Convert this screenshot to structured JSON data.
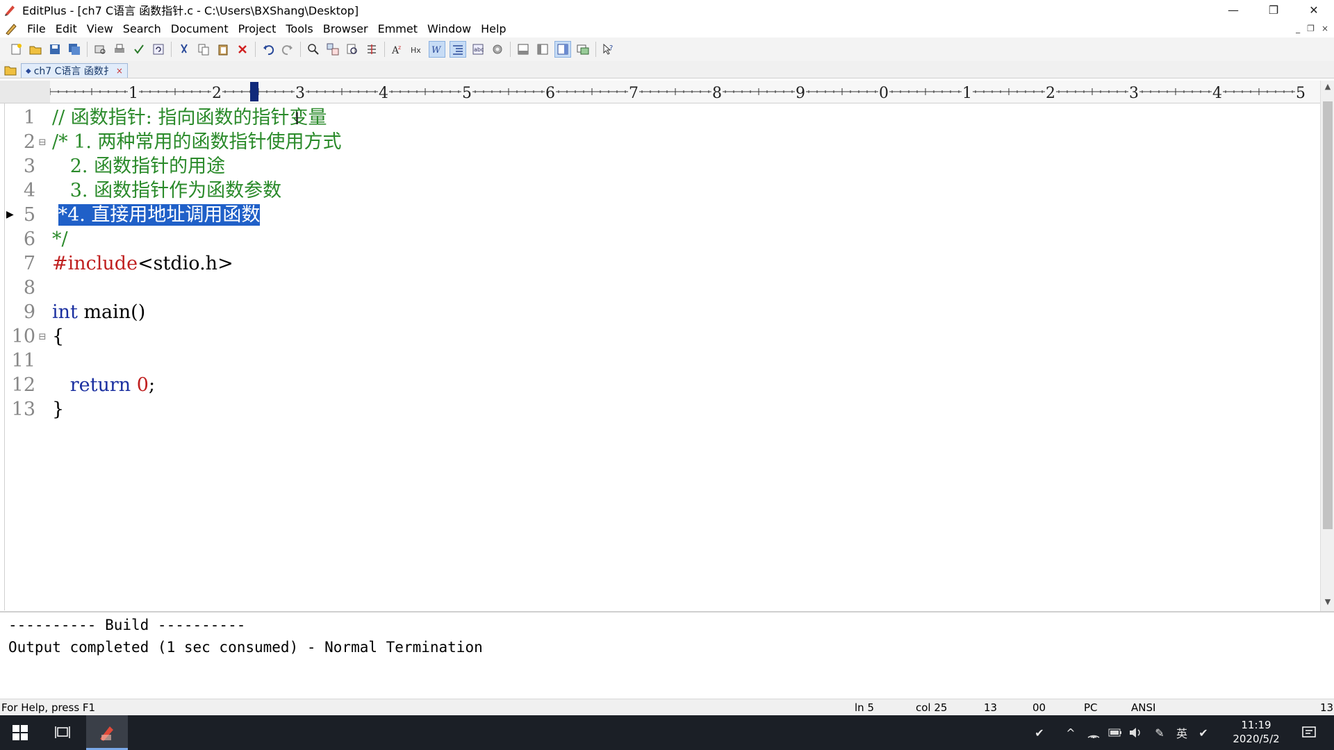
{
  "window": {
    "title": "EditPlus - [ch7 C语言 函数指针.c - C:\\Users\\BXShang\\Desktop]",
    "minimize": "—",
    "restore": "❐",
    "close": "✕"
  },
  "menu": {
    "items": [
      "File",
      "Edit",
      "View",
      "Search",
      "Document",
      "Project",
      "Tools",
      "Browser",
      "Emmet",
      "Window",
      "Help"
    ],
    "mdi_min": "_",
    "mdi_restore": "❐",
    "mdi_close": "×"
  },
  "tab": {
    "label": "ch7 C语言 函数扌",
    "close": "×"
  },
  "ruler": {
    "digits": [
      "1",
      "2",
      "3",
      "4",
      "5",
      "6",
      "7",
      "8",
      "9",
      "0",
      "1",
      "2",
      "3",
      "4",
      "5"
    ]
  },
  "editor": {
    "lines": [
      {
        "n": "1",
        "parts": [
          {
            "t": "// 函数指针: 指向函数的指针变量",
            "c": "comment"
          }
        ]
      },
      {
        "n": "2",
        "fold": "⊟",
        "parts": [
          {
            "t": "/* 1. 两种常用的函数指针使用方式",
            "c": "comment"
          }
        ]
      },
      {
        "n": "3",
        "parts": [
          {
            "t": "   2. 函数指针的用途",
            "c": "comment"
          }
        ]
      },
      {
        "n": "4",
        "parts": [
          {
            "t": "   3. 函数指针作为函数参数",
            "c": "comment"
          }
        ]
      },
      {
        "n": "5",
        "marker": "▶",
        "parts": [
          {
            "t": " ",
            "c": "plain"
          },
          {
            "t": "*4. 直接用地址调用函数",
            "c": "sel"
          }
        ]
      },
      {
        "n": "6",
        "parts": [
          {
            "t": "*/",
            "c": "comment"
          }
        ]
      },
      {
        "n": "7",
        "parts": [
          {
            "t": "#include",
            "c": "pre"
          },
          {
            "t": "<stdio.h>",
            "c": "plain"
          }
        ]
      },
      {
        "n": "8",
        "parts": []
      },
      {
        "n": "9",
        "parts": [
          {
            "t": "int",
            "c": "kw"
          },
          {
            "t": " main()",
            "c": "plain"
          }
        ]
      },
      {
        "n": "10",
        "fold": "⊟",
        "parts": [
          {
            "t": "{",
            "c": "plain"
          }
        ]
      },
      {
        "n": "11",
        "parts": []
      },
      {
        "n": "12",
        "parts": [
          {
            "t": "   ",
            "c": "plain"
          },
          {
            "t": "return",
            "c": "kw"
          },
          {
            "t": " ",
            "c": "plain"
          },
          {
            "t": "0",
            "c": "num"
          },
          {
            "t": ";",
            "c": "plain"
          }
        ]
      },
      {
        "n": "13",
        "parts": [
          {
            "t": "}",
            "c": "plain"
          }
        ]
      }
    ]
  },
  "output": {
    "line1": "---------- Build ----------",
    "line2": "Output completed (1 sec consumed) - Normal Termination"
  },
  "status": {
    "help": "For Help, press F1",
    "ln": "ln 5",
    "col": "col 25",
    "total": "13",
    "code": "00",
    "mode": "PC",
    "encoding": "ANSI",
    "right": "13"
  },
  "taskbar": {
    "time": "11:19",
    "date": "2020/5/2",
    "ime": "英"
  }
}
